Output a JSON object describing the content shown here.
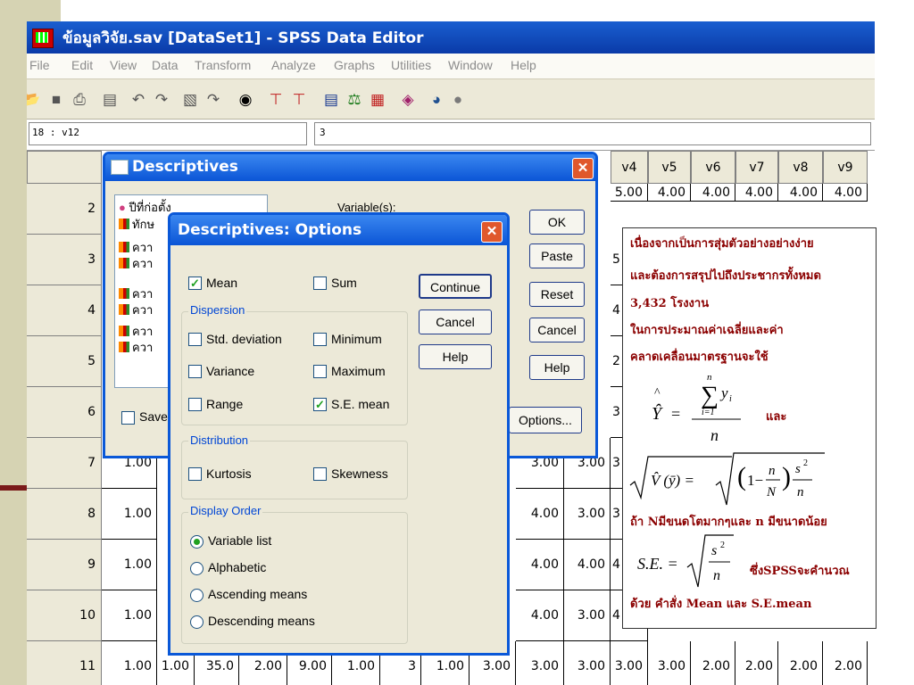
{
  "window": {
    "title": "ข้อมูลวิจัย.sav [DataSet1] - SPSS Data Editor"
  },
  "menu": [
    "File",
    "Edit",
    "View",
    "Data",
    "Transform",
    "Analyze",
    "Graphs",
    "Utilities",
    "Window",
    "Help"
  ],
  "cellbar": {
    "ref": "18 : v12",
    "value": "3"
  },
  "grid": {
    "col_headers": [
      "v4",
      "v5",
      "v6",
      "v7",
      "v8",
      "v9"
    ],
    "row_numbers": [
      "2",
      "3",
      "4",
      "5",
      "6",
      "7",
      "8",
      "9",
      "10",
      "11"
    ],
    "col_a_values": [
      "1.00",
      "1.00",
      "1.00",
      "1.00",
      "1.00"
    ],
    "mid_values": [
      [
        "3.00",
        "3.00"
      ],
      [
        "4.00",
        "3.00"
      ],
      [
        "4.00",
        "4.00"
      ],
      [
        "4.00",
        "3.00"
      ]
    ],
    "visible_v4_partial": [
      "5.00",
      "5",
      "4",
      "2",
      "3",
      "3",
      "3",
      "4",
      "4"
    ],
    "top_row_partial": [
      "4.00",
      "4.00",
      "4.00",
      "4.00",
      "4.00"
    ],
    "last_row": [
      "1.00",
      "1.00",
      "35.0",
      "2.00",
      "9.00",
      "1.00",
      "3",
      "1.00",
      "3.00",
      "3.00",
      "3.00",
      "3.00",
      "3.00",
      "2.00",
      "2.00",
      "2.00",
      "2.00"
    ]
  },
  "descriptives": {
    "title": "Descriptives",
    "variables_label": "Variable(s):",
    "list_items": [
      "ปีที่ก่อตั้ง",
      "ทักษ",
      "ควา",
      "ควา",
      "ควา",
      "ควา",
      "ควา",
      "ควา"
    ],
    "save_label": "Save",
    "buttons": [
      "OK",
      "Paste",
      "Reset",
      "Cancel",
      "Help"
    ],
    "options_label": "Options..."
  },
  "options": {
    "title": "Descriptives: Options",
    "mean": "Mean",
    "sum": "Sum",
    "dispersion": "Dispersion",
    "std": "Std. deviation",
    "minimum": "Minimum",
    "variance": "Variance",
    "maximum": "Maximum",
    "range": "Range",
    "se_mean": "S.E. mean",
    "distribution": "Distribution",
    "kurtosis": "Kurtosis",
    "skewness": "Skewness",
    "display_order": "Display Order",
    "variable_list": "Variable list",
    "alphabetic": "Alphabetic",
    "ascending": "Ascending means",
    "descending": "Descending means",
    "continue_label": "Continue",
    "cancel_label": "Cancel",
    "help_label": "Help"
  },
  "callout": {
    "line1": "เนื่องจากเป็นการสุ่มตัวอย่างอย่างง่าย",
    "line2": "และต้องการสรุปไปถึงประชากรทั้งหมด",
    "line3": "3,432 โรงงาน",
    "line4": "ในการประมาณค่าเฉลี่ยและค่า",
    "line5": "คลาดเคลื่อนมาตรฐานจะใช้",
    "and": "และ",
    "line6": "ถ้า Nมีขนดโตมากๆและ n มีขนาดน้อย",
    "line7": "ซึ่งSPSSจะคำนวณ",
    "line8": "ด้วย คำสั่ง Mean และ S.E.mean"
  }
}
